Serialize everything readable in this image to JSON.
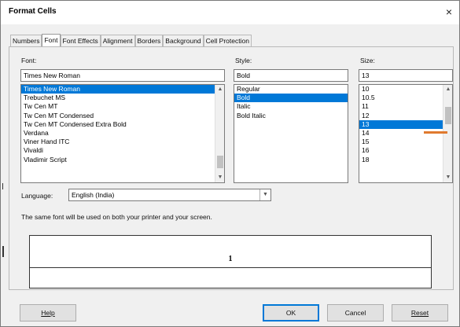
{
  "window": {
    "title": "Format Cells",
    "close_glyph": "×"
  },
  "tabs": [
    {
      "label": "Numbers"
    },
    {
      "label": "Font"
    },
    {
      "label": "Font Effects"
    },
    {
      "label": "Alignment"
    },
    {
      "label": "Borders"
    },
    {
      "label": "Background"
    },
    {
      "label": "Cell Protection"
    }
  ],
  "font": {
    "label": "Font:",
    "value": "Times New Roman",
    "items": [
      "Times New Roman",
      "Trebuchet MS",
      "Tw Cen MT",
      "Tw Cen MT Condensed",
      "Tw Cen MT Condensed Extra Bold",
      "Verdana",
      "Viner Hand ITC",
      "Vivaldi",
      "Vladimir Script"
    ],
    "selected": "Times New Roman"
  },
  "style": {
    "label": "Style:",
    "value": "Bold",
    "items": [
      "Regular",
      "Bold",
      "Italic",
      "Bold Italic"
    ],
    "selected": "Bold"
  },
  "size": {
    "label": "Size:",
    "value": "13",
    "items": [
      "10",
      "10.5",
      "11",
      "12",
      "13",
      "14",
      "15",
      "16",
      "18"
    ],
    "selected": "13"
  },
  "language": {
    "label": "Language:",
    "value": "English (India)"
  },
  "info_text": "The same font will be used on both your printer and your screen.",
  "preview": {
    "text": "1"
  },
  "buttons": {
    "help": "Help",
    "ok": "OK",
    "cancel": "Cancel",
    "reset": "Reset"
  },
  "colors": {
    "selection": "#0078d7",
    "annotation": "#e07a2f"
  }
}
